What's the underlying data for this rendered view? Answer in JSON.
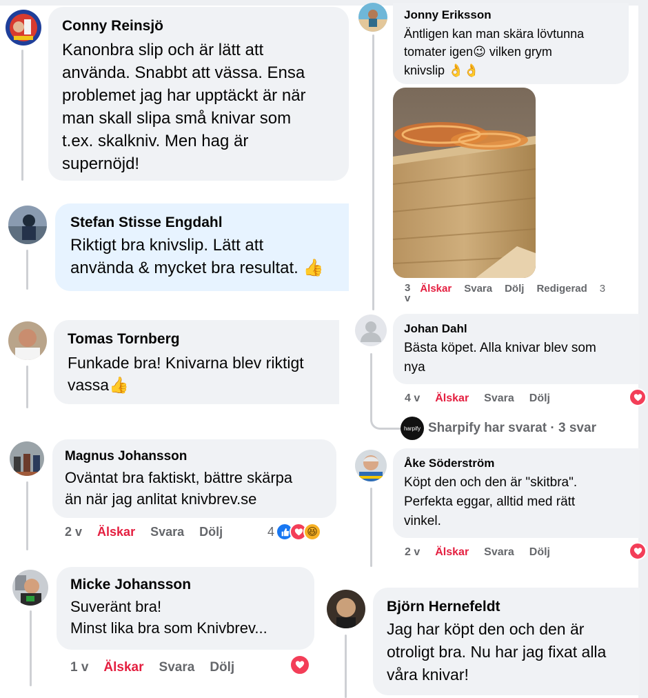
{
  "comments": {
    "conny": {
      "name": "Conny Reinsjö",
      "text": "Kanonbra slip och är lätt att\nanvända. Snabbt att vässa. Ensa\nproblemet jag har upptäckt är när\nman skall slipa små knivar som\nt.ex. skalkniv. Men hag är\nsupernöjd!"
    },
    "stefan": {
      "name": "Stefan Stisse Engdahl",
      "text": "Riktigt bra knivslip. Lätt att\nanvända & mycket bra resultat."
    },
    "tomas": {
      "name": "Tomas Tornberg",
      "text": "Funkade bra! Knivarna blev riktigt\nvassa"
    },
    "magnus": {
      "name": "Magnus Johansson",
      "text": "Oväntat bra faktiskt, bättre skärpa\nän när jag anlitat knivbrev.se",
      "time": "2 v",
      "reaction_count": "4"
    },
    "micke": {
      "name": "Micke Johansson",
      "text": "Suveränt bra!\nMinst lika bra som Knivbrev...",
      "time": "1 v"
    },
    "jonny": {
      "name": "Jonny Eriksson",
      "text": "Äntligen kan man skära lövtunna\ntomater igen",
      "text2": " vilken grym\nknivslip ",
      "time": "3\nv",
      "edited": "Redigerad",
      "count_partial": "3"
    },
    "johan": {
      "name": "Johan Dahl",
      "text": "Bästa köpet. Alla knivar blev som\nnya",
      "time": "4 v"
    },
    "sharpify": {
      "summary": "Sharpify har svarat · 3 svar",
      "logo_text": "harpify"
    },
    "ake": {
      "name": "Åke Söderström",
      "text": "Köpt den och den är \"skitbra\".\nPerfekta eggar, alltid med rätt\nvinkel.",
      "time": "2 v"
    },
    "bjorn": {
      "name": "Björn Hernefeldt",
      "text": "Jag har köpt den och den är\notroligt bra. Nu har jag fixat alla\nvåra knivar!"
    }
  },
  "actions": {
    "love": "Älskar",
    "reply": "Svara",
    "hide": "Dölj"
  },
  "emoji": {
    "thumbs": "👍",
    "wink": "😉",
    "ok": "👌",
    "laugh": "😆"
  },
  "icons": {
    "like": "like-reaction-icon",
    "heart": "heart-reaction-icon",
    "haha": "haha-reaction-icon"
  },
  "colors": {
    "love_red": "#e41e3f",
    "like_blue": "#1877f2",
    "bubble_gray": "#f0f2f5",
    "bubble_blue": "#e7f3ff",
    "meta_gray": "#65676b"
  }
}
